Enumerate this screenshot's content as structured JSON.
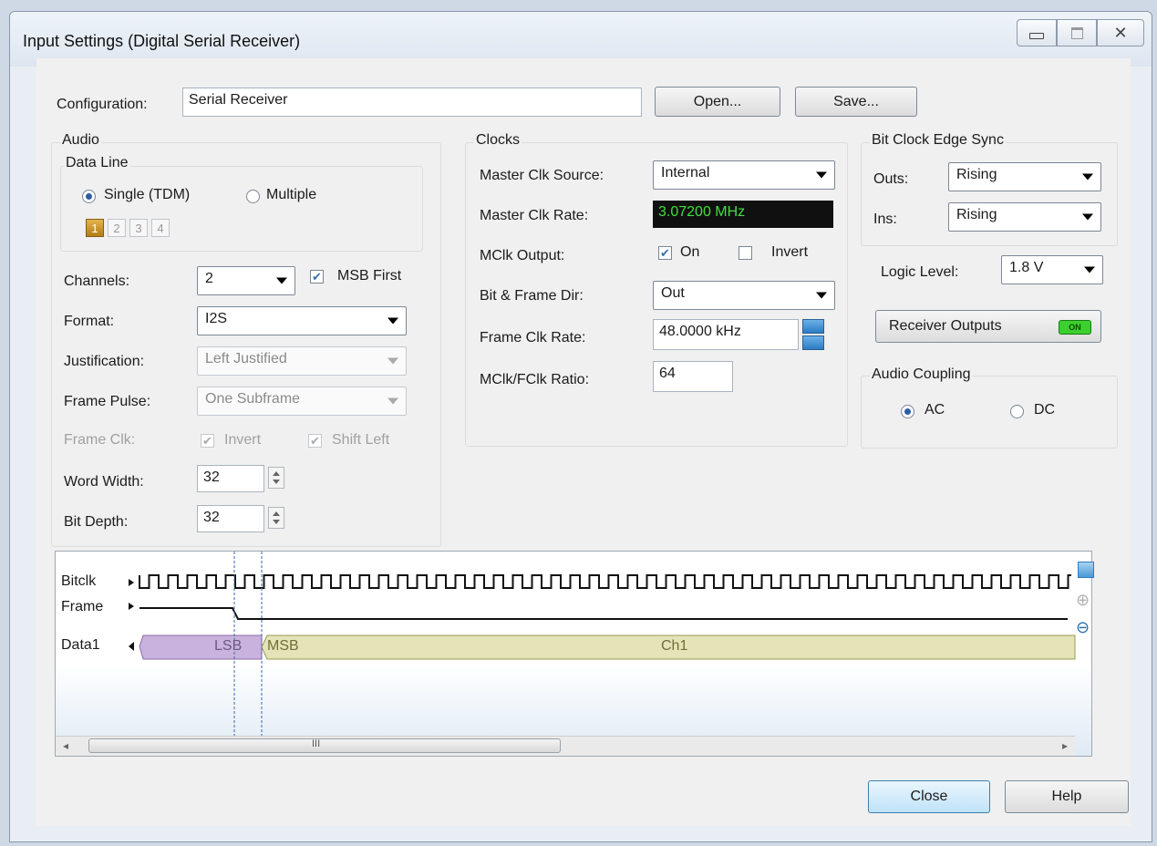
{
  "window": {
    "title": "Input Settings (Digital Serial Receiver)"
  },
  "config": {
    "label": "Configuration:",
    "value": "Serial Receiver",
    "open_label": "Open...",
    "save_label": "Save..."
  },
  "audio": {
    "title": "Audio",
    "data_line": {
      "title": "Data Line",
      "single_label": "Single (TDM)",
      "multiple_label": "Multiple",
      "selected": "single",
      "channels": [
        "1",
        "2",
        "3",
        "4"
      ],
      "active_channel": "1"
    },
    "channels_label": "Channels:",
    "channels_value": "2",
    "msb_first_label": "MSB First",
    "format_label": "Format:",
    "format_value": "I2S",
    "justification_label": "Justification:",
    "justification_value": "Left Justified",
    "frame_pulse_label": "Frame Pulse:",
    "frame_pulse_value": "One Subframe",
    "frame_clk_label": "Frame Clk:",
    "invert_label": "Invert",
    "shift_left_label": "Shift Left",
    "word_width_label": "Word Width:",
    "word_width_value": "32",
    "bit_depth_label": "Bit Depth:",
    "bit_depth_value": "32"
  },
  "clocks": {
    "title": "Clocks",
    "master_src_label": "Master Clk Source:",
    "master_src_value": "Internal",
    "master_rate_label": "Master Clk Rate:",
    "master_rate_value": "3.07200 MHz",
    "mclk_output_label": "MClk Output:",
    "on_label": "On",
    "invert_label": "Invert",
    "bit_frame_dir_label": "Bit & Frame Dir:",
    "bit_frame_dir_value": "Out",
    "frame_rate_label": "Frame Clk Rate:",
    "frame_rate_value": "48.0000 kHz",
    "ratio_label": "MClk/FClk Ratio:",
    "ratio_value": "64"
  },
  "bit_clock_sync": {
    "title": "Bit Clock Edge Sync",
    "outs_label": "Outs:",
    "outs_value": "Rising",
    "ins_label": "Ins:",
    "ins_value": "Rising"
  },
  "logic_level": {
    "label": "Logic Level:",
    "value": "1.8 V"
  },
  "receiver_outputs": {
    "label": "Receiver Outputs",
    "led": "ON"
  },
  "audio_coupling": {
    "title": "Audio Coupling",
    "ac_label": "AC",
    "dc_label": "DC",
    "selected": "ac"
  },
  "timing": {
    "bitclk_label": "Bitclk",
    "frame_label": "Frame",
    "data_label": "Data1",
    "lsb_label": "LSB",
    "msb_label": "MSB",
    "ch_label": "Ch1",
    "scroll_grip": "III",
    "colors": {
      "lsb_fill": "#c9b2dd",
      "ch_fill": "#e4e4b8"
    }
  },
  "footer": {
    "close_label": "Close",
    "help_label": "Help"
  },
  "colors": {
    "rate_display_bg": "#101010",
    "rate_display_fg": "#3ee03e",
    "led_on": "#3bd02e"
  }
}
